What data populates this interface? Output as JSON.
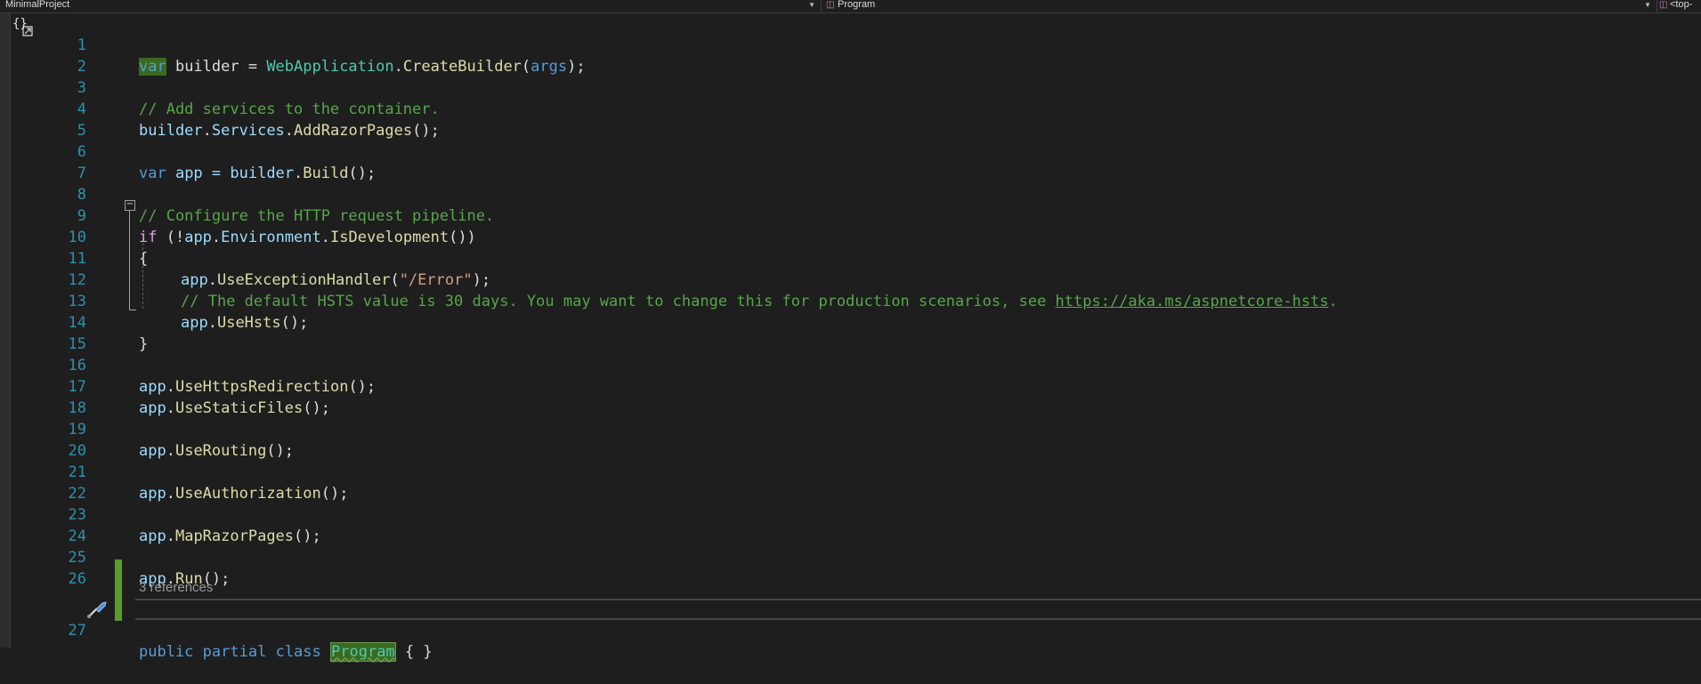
{
  "navbar": {
    "project": "MinimalProject",
    "class": "Program",
    "member": "<top-",
    "class_icon": "class-icon",
    "member_icon": "member-icon",
    "dropdown_icon": "dropdown-arrow-icon"
  },
  "editor": {
    "references_lens": "3 references",
    "line_numbers": [
      "1",
      "2",
      "3",
      "4",
      "5",
      "6",
      "7",
      "8",
      "9",
      "10",
      "11",
      "12",
      "13",
      "14",
      "15",
      "16",
      "17",
      "18",
      "19",
      "20",
      "21",
      "22",
      "23",
      "24",
      "25",
      "26",
      "27"
    ],
    "code": {
      "l1": {
        "a": "var",
        "b": " builder = ",
        "c": "WebApplication",
        ".": ".",
        "d": "CreateBuilder",
        "e": "(",
        "f": "args",
        "g": ");"
      },
      "l3": "// Add services to the container.",
      "l4": {
        "a": "builder",
        ".1": ".",
        "b": "Services",
        ".2": ".",
        "c": "AddRazorPages",
        "d": "();"
      },
      "l6": {
        "a": "var",
        "b": " app = ",
        "c": "builder",
        ".": ".",
        "d": "Build",
        "e": "();"
      },
      "l8": "// Configure the HTTP request pipeline.",
      "l9": {
        "a": "if",
        "b": " (!",
        "c": "app",
        ".1": ".",
        "d": "Environment",
        ".2": ".",
        "e": "IsDevelopment",
        "f": "())"
      },
      "l10": "{",
      "l11": {
        "a": "app",
        ".": ".",
        "b": "UseExceptionHandler",
        "c": "(",
        "d": "\"/Error\"",
        "e": ");"
      },
      "l12": {
        "a": "// The default HSTS value is 30 days. You may want to change this for production scenarios, see ",
        "link": "https://aka.ms/aspnetcore-hsts",
        "b": "."
      },
      "l13": {
        "a": "app",
        ".": ".",
        "b": "UseHsts",
        "c": "();"
      },
      "l14": "}",
      "l16": {
        "a": "app",
        ".": ".",
        "b": "UseHttpsRedirection",
        "c": "();"
      },
      "l17": {
        "a": "app",
        ".": ".",
        "b": "UseStaticFiles",
        "c": "();"
      },
      "l19": {
        "a": "app",
        ".": ".",
        "b": "UseRouting",
        "c": "();"
      },
      "l21": {
        "a": "app",
        ".": ".",
        "b": "UseAuthorization",
        "c": "();"
      },
      "l23": {
        "a": "app",
        ".": ".",
        "b": "MapRazorPages",
        "c": "();"
      },
      "l25": {
        "a": "app",
        ".": ".",
        "b": "Run",
        "c": "();"
      },
      "l27": {
        "a": "public",
        "b": "partial",
        "c": "class",
        "d": "Program",
        "e": "{ }"
      }
    }
  },
  "colors": {
    "keyword": "#569cd6",
    "type": "#4ec9b0",
    "method": "#dcdcaa",
    "string": "#d69d85",
    "comment": "#57a64a",
    "line_number": "#2b91af",
    "change_bar": "#5c9c2a"
  }
}
